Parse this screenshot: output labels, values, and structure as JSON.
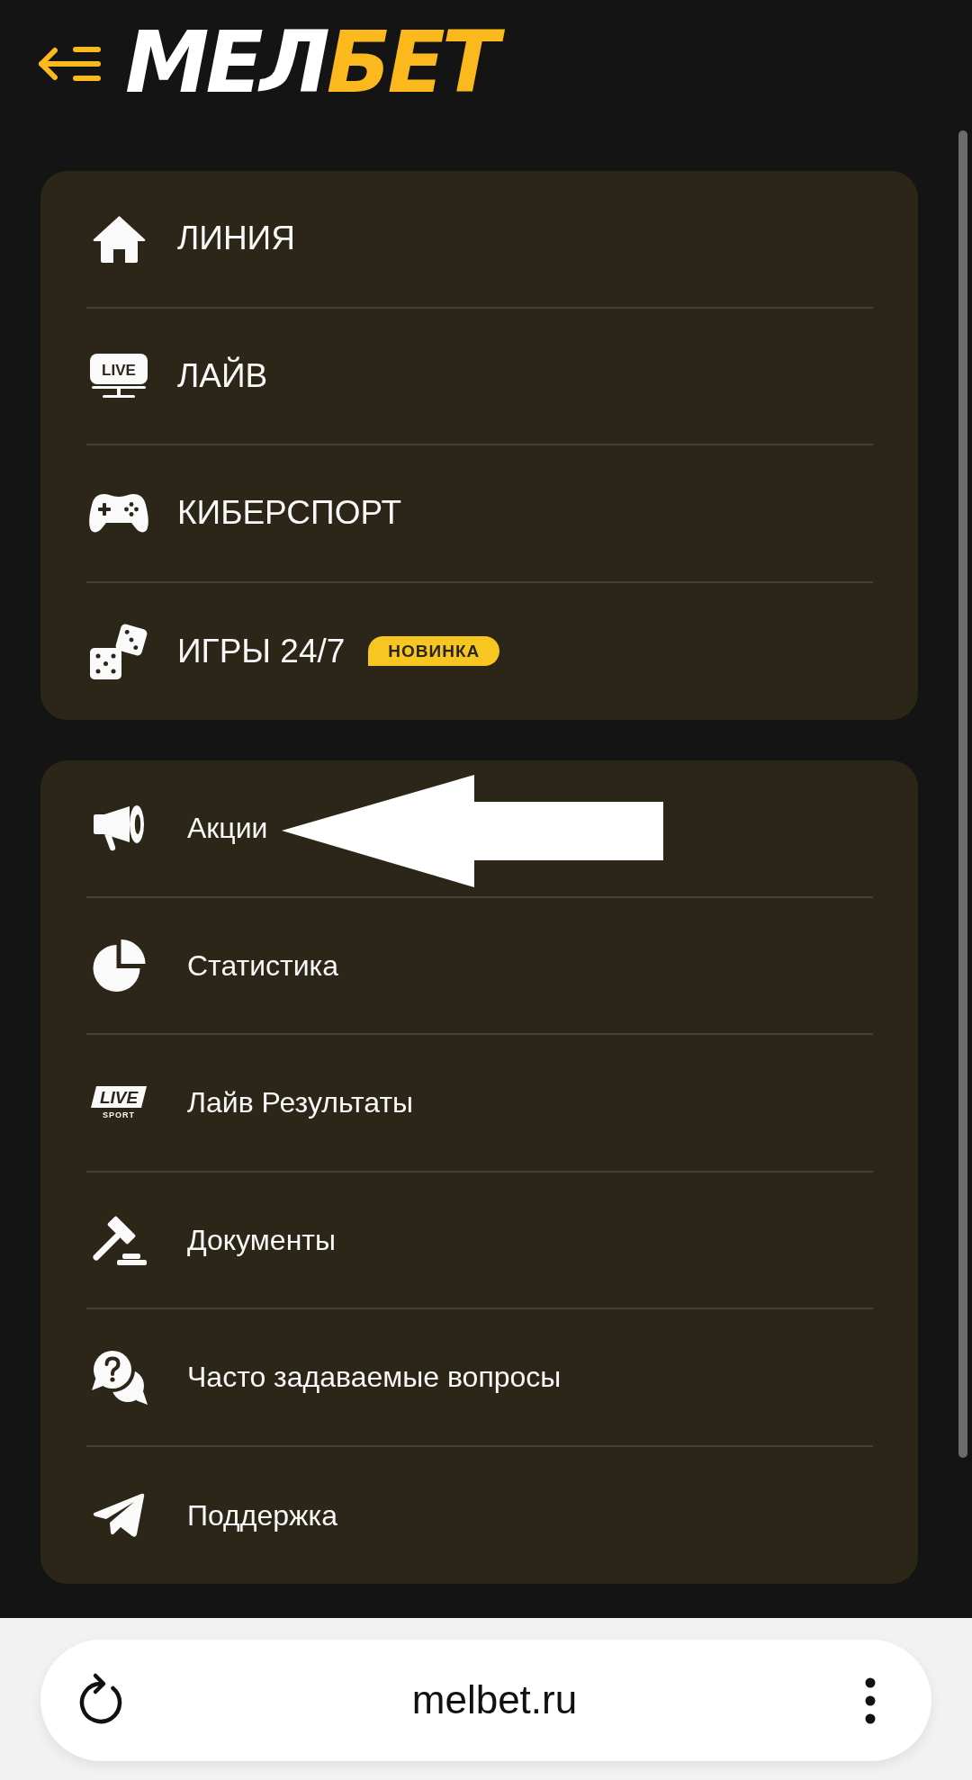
{
  "header": {
    "logo": [
      {
        "text": "МЕЛ",
        "color": "#ffffff"
      },
      {
        "text": "БЕТ",
        "color": "#fbb91d"
      }
    ]
  },
  "main_menu": {
    "items": [
      {
        "label": "ЛИНИЯ"
      },
      {
        "label": "ЛАЙВ",
        "icon_text": "LIVE"
      },
      {
        "label": "КИБЕРСПОРТ"
      },
      {
        "label": "ИГРЫ 24/7",
        "badge": "НОВИНКА"
      }
    ]
  },
  "secondary_menu": {
    "items": [
      {
        "label": "Акции"
      },
      {
        "label": "Статистика"
      },
      {
        "label": "Лайв Результаты",
        "icon_text": "LIVE",
        "icon_subtext": "SPORT"
      },
      {
        "label": "Документы"
      },
      {
        "label": "Часто задаваемые вопросы"
      },
      {
        "label": "Поддержка"
      }
    ]
  },
  "browser_bar": {
    "url": "melbet.ru"
  }
}
